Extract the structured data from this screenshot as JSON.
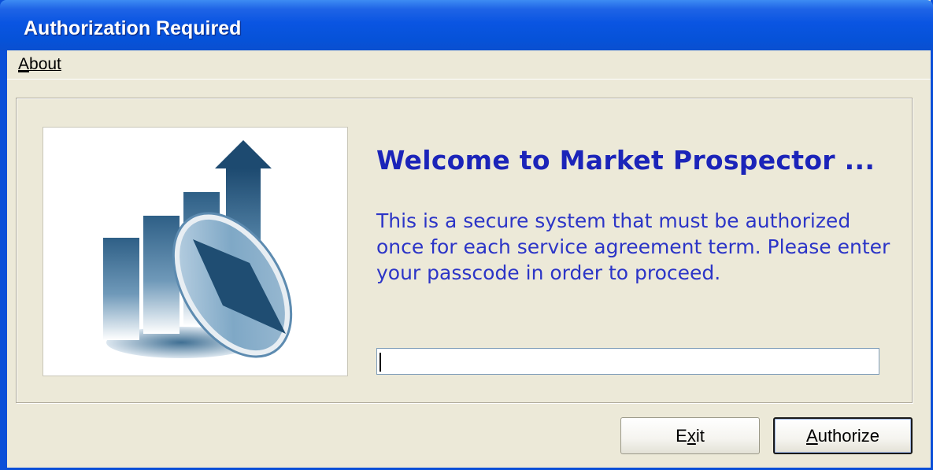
{
  "window": {
    "title": "Authorization Required"
  },
  "menu": {
    "items": [
      {
        "label": "About",
        "mnemonic": "A"
      }
    ]
  },
  "main": {
    "logo_icon": "market-prospector-logo-icon",
    "welcome": "Welcome to Market Prospector ...",
    "description": "This is a secure system that must be authorized once for each service agreement term.  Please enter your passcode in order to proceed.",
    "passcode_value": ""
  },
  "buttons": {
    "exit_pre": "E",
    "exit_mn": "x",
    "exit_post": "it",
    "authorize_pre": "",
    "authorize_mn": "A",
    "authorize_post": "uthorize"
  },
  "colors": {
    "titlebar": "#0a55e2",
    "window_bg": "#ece9d8",
    "welcome_text": "#1b24b9",
    "description_text": "#2c35c7"
  }
}
